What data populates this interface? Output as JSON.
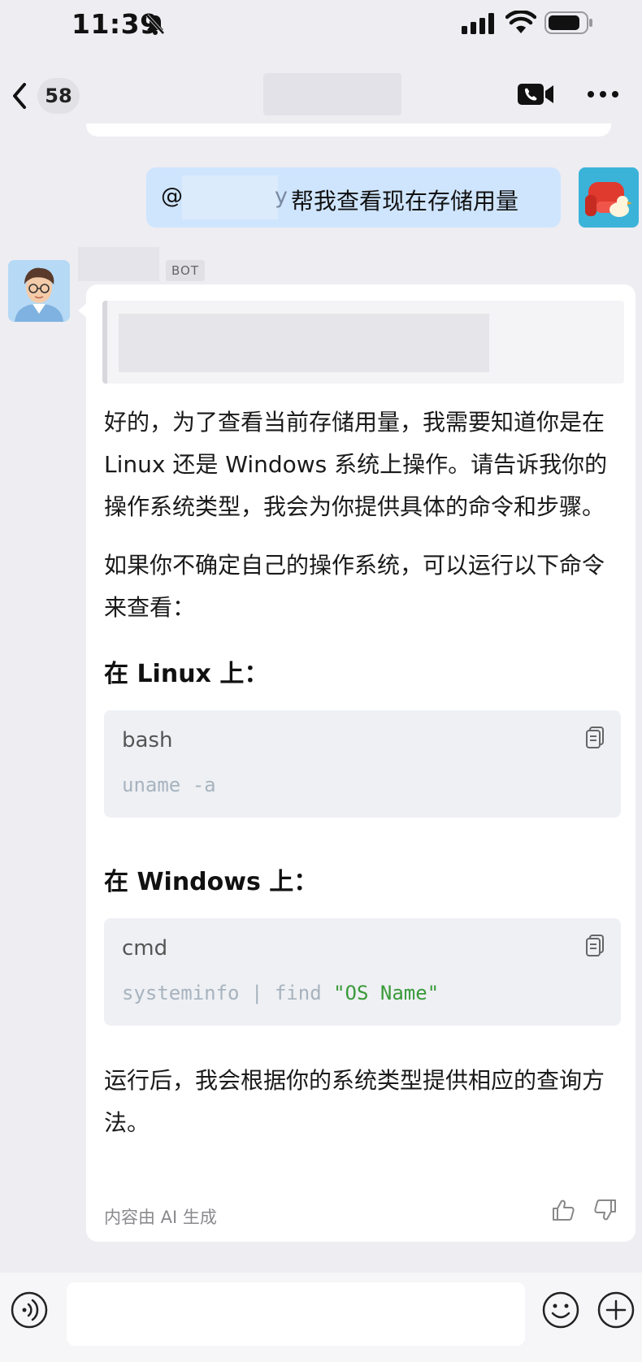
{
  "status_bar": {
    "time": "11:39"
  },
  "nav": {
    "unread_count": "58"
  },
  "user_message": {
    "at_sign": "@",
    "mention_tail": "y",
    "text": "帮我查看现在存储用量"
  },
  "bot": {
    "badge": "BOT",
    "paragraph_1": "好的，为了查看当前存储用量，我需要知道你是在 Linux 还是 Windows 系统上操作。请告诉我你的操作系统类型，我会为你提供具体的命令和步骤。",
    "paragraph_2": "如果你不确定自己的操作系统，可以运行以下命令来查看：",
    "linux_heading": "在 Linux 上：",
    "linux_code": {
      "lang": "bash",
      "command": "uname -a"
    },
    "windows_heading": "在 Windows 上：",
    "windows_code": {
      "lang": "cmd",
      "command": "systeminfo | find ",
      "string": "\"OS Name\""
    },
    "paragraph_3": "运行后，我会根据你的系统类型提供相应的查询方法。",
    "ai_note": "内容由 AI 生成"
  },
  "colors": {
    "background": "#EDEDF2",
    "user_bubble": "#CFE5FE",
    "code_block": "#EEF0F4",
    "code_string": "#3A9A3A"
  }
}
